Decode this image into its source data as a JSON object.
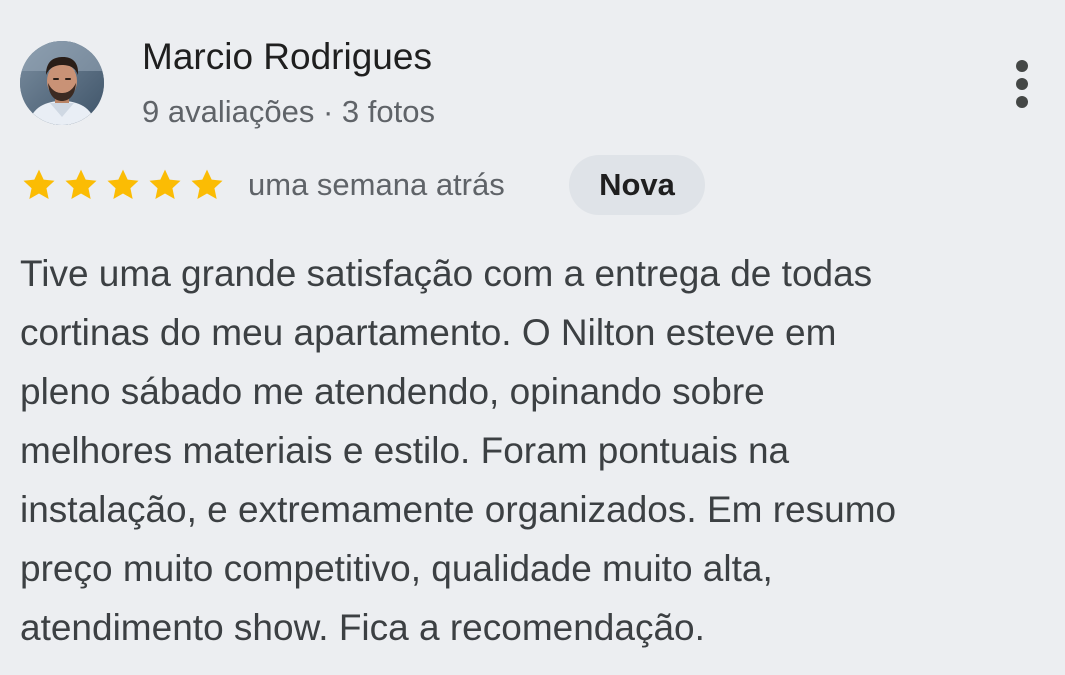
{
  "review": {
    "author": {
      "name": "Marcio Rodrigues",
      "meta": "9 avaliações · 3 fotos",
      "avatar": "profile-photo"
    },
    "menu_icon": "more-vertical-icon",
    "rating": {
      "stars": 5,
      "max_stars": 5,
      "star_color": "#fbbc04"
    },
    "time_ago": "uma semana atrás",
    "badge": "Nova",
    "text_lines": [
      "Tive uma grande satisfação com a entrega de todas",
      "cortinas do meu apartamento. O Nilton esteve em",
      "pleno sábado me atendendo, opinando sobre",
      "melhores materiais e estilo. Foram pontuais na",
      "instalação, e extremamente organizados. Em resumo",
      "preço muito competitivo, qualidade muito alta,",
      "atendimento show. Fica a recomendação."
    ]
  }
}
